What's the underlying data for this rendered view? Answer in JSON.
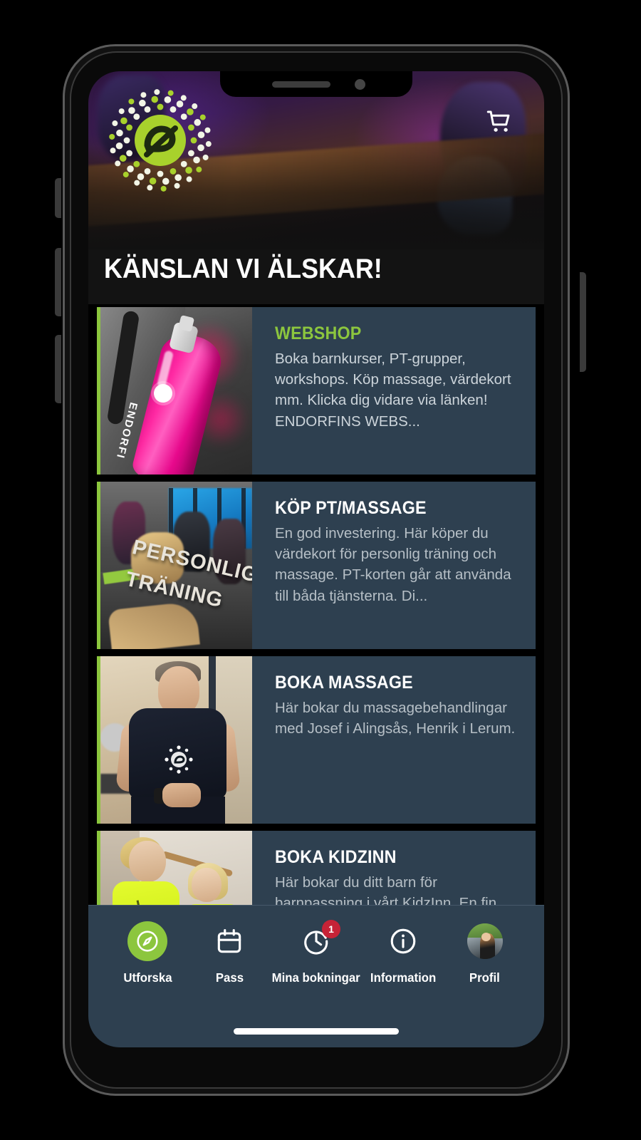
{
  "app": {
    "header": {
      "logo_icon": "endorfin-e-logo-icon",
      "cart_icon": "shopping-cart-icon",
      "page_title": "KÄNSLAN VI ÄLSKAR!"
    },
    "colors": {
      "accent_green": "#8cc63e",
      "card_background": "#2e4050",
      "nav_background": "#2e4050",
      "badge_red": "#c62337",
      "screen_background": "#000000",
      "title_band": "#131313",
      "body_text": "#b6bfc6"
    },
    "cards": [
      {
        "title": "WEBSHOP",
        "title_color": "green",
        "description": " Boka barnkurser, PT-grupper, workshops. Köp massage, värdekort mm. Klicka dig vidare via länken! ENDORFINS WEBS...",
        "thumb_name": "pink-bottle-photo",
        "thumb_overlay": "ENDORFI"
      },
      {
        "title": "KÖP PT/MASSAGE",
        "title_color": "white",
        "description": "En god investering. Här köper du värdekort för personlig träning och massage. PT-korten går att använda till båda tjänsterna. Di...",
        "thumb_name": "personal-training-photo",
        "thumb_overlay_line1": "PERSONLIG",
        "thumb_overlay_line2": "TRÄNING"
      },
      {
        "title": "BOKA MASSAGE",
        "title_color": "white",
        "description": "Här bokar du massagebehandlingar med Josef i Alingsås, Henrik i Lerum.",
        "thumb_name": "trainer-portrait-photo"
      },
      {
        "title": "BOKA KIDZINN",
        "title_color": "white",
        "description": "Här bokar du ditt barn för barnpassning i vårt KidzInn. En fin förmån för dig medlem. Du kan boka 4 dygn framåt.",
        "thumb_name": "kidzinn-photo"
      }
    ],
    "bottom_nav": [
      {
        "label": "Utforska",
        "icon": "compass-icon",
        "active": true,
        "badge": null
      },
      {
        "label": "Pass",
        "icon": "calendar-icon",
        "active": false,
        "badge": null
      },
      {
        "label": "Mina bokningar",
        "icon": "clock-icon",
        "active": false,
        "badge": "1"
      },
      {
        "label": "Information",
        "icon": "info-circle-icon",
        "active": false,
        "badge": null
      },
      {
        "label": "Profil",
        "icon": "user-avatar-icon",
        "active": false,
        "badge": null
      }
    ]
  }
}
